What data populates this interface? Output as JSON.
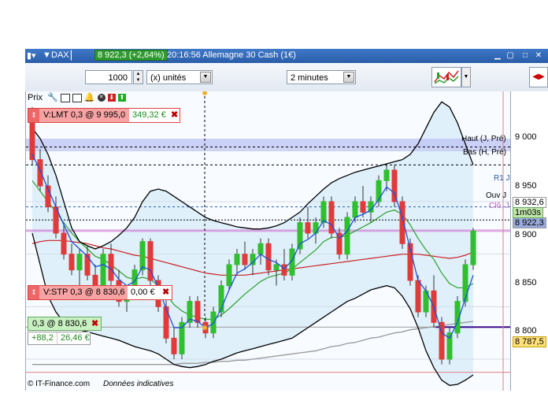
{
  "window": {
    "instrument": "DAX",
    "price_change": "8 922,3 (+2,64%)",
    "time_title": "20:16:56 Allemagne 30 Cash (1€)"
  },
  "toolbar": {
    "quantity": "1000",
    "unit": "(x) unités",
    "interval": "2 minutes"
  },
  "prix_bar": {
    "label": "Prix"
  },
  "orders": {
    "limit": {
      "label": "V:LMT 0,3 @ 9 995,0",
      "value": "349,32 €"
    },
    "stop": {
      "label": "V:STP 0,3 @ 8 830,6",
      "value": "0,00 €"
    },
    "position": {
      "label": "0,3 @ 8 830,6",
      "points": "+88,2",
      "pnl": "26,46 €"
    }
  },
  "levels": {
    "haut": "Haut (J, Pré)",
    "bas": "Bas (H, Pré)",
    "r1": "R1 J",
    "ouv": "Ouv J",
    "clo": "Clô. J"
  },
  "yaxis": {
    "ticks": [
      "9 000",
      "8 950",
      "8 900",
      "8 850",
      "8 800"
    ],
    "current_price": "8 932,6",
    "countdown": "1m03s",
    "close_price": "8 922,3",
    "bottom_price": "8 787,5"
  },
  "footer": {
    "copyright": "© IT-Finance.com",
    "note": "Données indicatives"
  },
  "colors": {
    "bull": "#2fbf2f",
    "bear": "#e03a3a",
    "title_bg": "#2a5da8",
    "price_green": "#2f9a2f"
  },
  "chart_data": {
    "type": "candlestick",
    "interval": "2 minutes",
    "ylim": [
      8770,
      9055
    ],
    "yticks": [
      9000,
      8950,
      8900,
      8850,
      8800
    ],
    "candles": [
      [
        9030,
        9040,
        8985,
        8990
      ],
      [
        8990,
        9000,
        8960,
        8965
      ],
      [
        8965,
        8975,
        8940,
        8945
      ],
      [
        8945,
        8955,
        8915,
        8920
      ],
      [
        8920,
        8930,
        8895,
        8900
      ],
      [
        8900,
        8910,
        8880,
        8885
      ],
      [
        8885,
        8905,
        8870,
        8900
      ],
      [
        8900,
        8908,
        8875,
        8880
      ],
      [
        8880,
        8890,
        8860,
        8865
      ],
      [
        8865,
        8905,
        8860,
        8900
      ],
      [
        8900,
        8910,
        8870,
        8875
      ],
      [
        8875,
        8885,
        8850,
        8855
      ],
      [
        8855,
        8870,
        8845,
        8865
      ],
      [
        8865,
        8890,
        8860,
        8885
      ],
      [
        8885,
        8915,
        8880,
        8912
      ],
      [
        8912,
        8915,
        8870,
        8875
      ],
      [
        8875,
        8880,
        8845,
        8850
      ],
      [
        8850,
        8860,
        8815,
        8820
      ],
      [
        8820,
        8830,
        8800,
        8805
      ],
      [
        8805,
        8840,
        8800,
        8835
      ],
      [
        8835,
        8860,
        8830,
        8855
      ],
      [
        8855,
        8860,
        8830,
        8835
      ],
      [
        8835,
        8840,
        8820,
        8825
      ],
      [
        8825,
        8850,
        8820,
        8845
      ],
      [
        8845,
        8875,
        8840,
        8870
      ],
      [
        8870,
        8895,
        8865,
        8890
      ],
      [
        8890,
        8905,
        8880,
        8900
      ],
      [
        8900,
        8912,
        8885,
        8890
      ],
      [
        8890,
        8905,
        8880,
        8900
      ],
      [
        8900,
        8915,
        8890,
        8910
      ],
      [
        8910,
        8915,
        8880,
        8885
      ],
      [
        8885,
        8895,
        8870,
        8890
      ],
      [
        8890,
        8905,
        8875,
        8880
      ],
      [
        8880,
        8910,
        8875,
        8905
      ],
      [
        8905,
        8935,
        8900,
        8930
      ],
      [
        8930,
        8945,
        8915,
        8920
      ],
      [
        8920,
        8935,
        8910,
        8930
      ],
      [
        8930,
        8955,
        8925,
        8950
      ],
      [
        8950,
        8955,
        8915,
        8920
      ],
      [
        8920,
        8925,
        8895,
        8900
      ],
      [
        8900,
        8940,
        8895,
        8935
      ],
      [
        8935,
        8955,
        8930,
        8950
      ],
      [
        8950,
        8965,
        8935,
        8940
      ],
      [
        8940,
        8955,
        8930,
        8950
      ],
      [
        8950,
        8975,
        8945,
        8970
      ],
      [
        8970,
        8985,
        8960,
        8980
      ],
      [
        8980,
        8985,
        8945,
        8950
      ],
      [
        8950,
        8955,
        8905,
        8910
      ],
      [
        8910,
        8915,
        8870,
        8875
      ],
      [
        8875,
        8880,
        8840,
        8845
      ],
      [
        8845,
        8870,
        8840,
        8865
      ],
      [
        8865,
        8880,
        8830,
        8835
      ],
      [
        8835,
        8840,
        8795,
        8800
      ],
      [
        8800,
        8830,
        8795,
        8825
      ],
      [
        8825,
        8860,
        8820,
        8855
      ],
      [
        8855,
        8895,
        8850,
        8890
      ],
      [
        8890,
        8925,
        8885,
        8922
      ]
    ],
    "lines": {
      "upper_band": [
        9020,
        9010,
        8995,
        8975,
        8950,
        8925,
        8912,
        8908,
        8905,
        8908,
        8912,
        8918,
        8925,
        8935,
        8950,
        8960,
        8962,
        8960,
        8955,
        8950,
        8945,
        8940,
        8935,
        8932,
        8930,
        8928,
        8926,
        8925,
        8924,
        8924,
        8925,
        8927,
        8930,
        8935,
        8940,
        8948,
        8955,
        8962,
        8968,
        8972,
        8975,
        8978,
        8980,
        8982,
        8984,
        8986,
        8988,
        8990,
        8995,
        9005,
        9020,
        9035,
        9045,
        9040,
        9025,
        9005,
        8985
      ],
      "lower_band": [
        8920,
        8890,
        8860,
        8845,
        8835,
        8830,
        8828,
        8826,
        8824,
        8822,
        8820,
        8818,
        8815,
        8812,
        8810,
        8808,
        8805,
        8800,
        8795,
        8793,
        8792,
        8793,
        8795,
        8798,
        8800,
        8803,
        8806,
        8808,
        8810,
        8812,
        8814,
        8816,
        8818,
        8820,
        8825,
        8830,
        8835,
        8840,
        8845,
        8850,
        8855,
        8858,
        8862,
        8866,
        8868,
        8870,
        8868,
        8860,
        8848,
        8830,
        8808,
        8792,
        8780,
        8775,
        8776,
        8780,
        8785
      ],
      "fast_ma": [
        8995,
        8980,
        8962,
        8945,
        8928,
        8912,
        8905,
        8898,
        8888,
        8890,
        8886,
        8876,
        8870,
        8874,
        8888,
        8885,
        8868,
        8848,
        8830,
        8830,
        8838,
        8836,
        8830,
        8834,
        8848,
        8866,
        8882,
        8886,
        8892,
        8900,
        8895,
        8892,
        8886,
        8894,
        8910,
        8914,
        8920,
        8932,
        8928,
        8915,
        8922,
        8935,
        8938,
        8942,
        8952,
        8964,
        8958,
        8935,
        8905,
        8875,
        8865,
        8850,
        8825,
        8820,
        8835,
        8858,
        8880
      ],
      "green_ma": [
        8970,
        8960,
        8950,
        8940,
        8930,
        8920,
        8912,
        8905,
        8898,
        8895,
        8890,
        8884,
        8878,
        8876,
        8878,
        8876,
        8870,
        8862,
        8852,
        8846,
        8842,
        8840,
        8838,
        8838,
        8842,
        8848,
        8855,
        8862,
        8868,
        8874,
        8878,
        8880,
        8882,
        8886,
        8892,
        8898,
        8904,
        8912,
        8916,
        8916,
        8918,
        8922,
        8926,
        8930,
        8935,
        8940,
        8942,
        8938,
        8928,
        8915,
        8904,
        8895,
        8882,
        8872,
        8868,
        8868,
        8872
      ],
      "red_ma": [
        8910,
        8912,
        8913,
        8913,
        8913,
        8912,
        8911,
        8910,
        8908,
        8906,
        8905,
        8903,
        8901,
        8899,
        8898,
        8896,
        8894,
        8892,
        8890,
        8888,
        8886,
        8884,
        8882,
        8881,
        8880,
        8880,
        8880,
        8880,
        8881,
        8882,
        8883,
        8884,
        8885,
        8886,
        8887,
        8888,
        8889,
        8890,
        8891,
        8892,
        8893,
        8894,
        8895,
        8896,
        8897,
        8898,
        8899,
        8900,
        8900,
        8900,
        8899,
        8898,
        8897,
        8896,
        8897,
        8899,
        8902
      ],
      "gray_ma": [
        8795,
        8795,
        8795,
        8795,
        8795,
        8795,
        8795,
        8795,
        8795,
        8795,
        8795,
        8795,
        8795,
        8795,
        8795,
        8795,
        8795,
        8795,
        8795,
        8796,
        8796,
        8796,
        8797,
        8797,
        8798,
        8798,
        8799,
        8799,
        8800,
        8801,
        8802,
        8803,
        8804,
        8805,
        8806,
        8807,
        8808,
        8810,
        8812,
        8813,
        8815,
        8816,
        8818,
        8820,
        8821,
        8823,
        8825,
        8826,
        8828,
        8829,
        8830,
        8831,
        8832,
        8833,
        8834,
        8835,
        8836
      ]
    },
    "horizontal_levels": {
      "haut": 9002,
      "bas": 8985,
      "r1": 8945,
      "ouv": 8932.6,
      "clo": 8922.3,
      "stop": 8830.6,
      "low": 8787.5
    }
  }
}
